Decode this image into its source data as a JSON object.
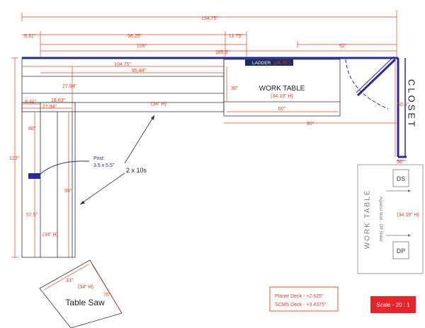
{
  "colors": {
    "dimension": "#e8401c",
    "wall": "#2a2a9a",
    "ladder_bg": "#1c2c5c",
    "scale_bg": "#e8232a"
  },
  "dimensions": {
    "total_width": "194.75\"",
    "left_offset": "9.31\"",
    "span_9625": "96.25\"",
    "span_1175": "11.75\"",
    "span_108": "108\"",
    "span_52": "52\"",
    "span_1855": "185.5\"",
    "bench_10475": "104.75\"",
    "bench_9544": "95.44\"",
    "bench_depth_2794": "27.94\"",
    "small_931": "9.31\"",
    "small_1863": "18.63\"",
    "small_2794": "27.94\"",
    "vertical_123": "123\"",
    "vertical_60": "60\"",
    "vertical_575": "57.5\"",
    "vertical_95": "95\"",
    "work_table_30": "30\"",
    "work_table_60": "60\"",
    "span_90": "90\"",
    "closet_505": "50.5\"",
    "closet_56": "56\"",
    "table_saw_33": "33\"",
    "table_saw_70": "70\""
  },
  "labels": {
    "ladder": "LADDER",
    "ladder_value": "(26.25\")",
    "work_table": "WORK  TABLE",
    "work_table_height": "(34.19\" H)",
    "bench_height": "(34\" H)",
    "left_bench_height": "(34\" H)",
    "closet": "CLOSET",
    "post_title": "Post:",
    "post_size": "3.5 x 5.5\"",
    "two_by_tens": "2 x 10s",
    "table_saw": "Table Saw",
    "table_saw_height": "(34\" H)",
    "side_work_table": "WORK TABLE",
    "side_against_wall": "Against Wall - Off Sheet",
    "side_height": "(34.19\" H)",
    "ds": "DS",
    "dp": "DP",
    "scale": "Scale - 20 : 1"
  },
  "notes": {
    "planer_deck": "Planer Deck  -  +2.625\"",
    "scms_deck": "SCMS Deck  -  +3.4375\""
  }
}
